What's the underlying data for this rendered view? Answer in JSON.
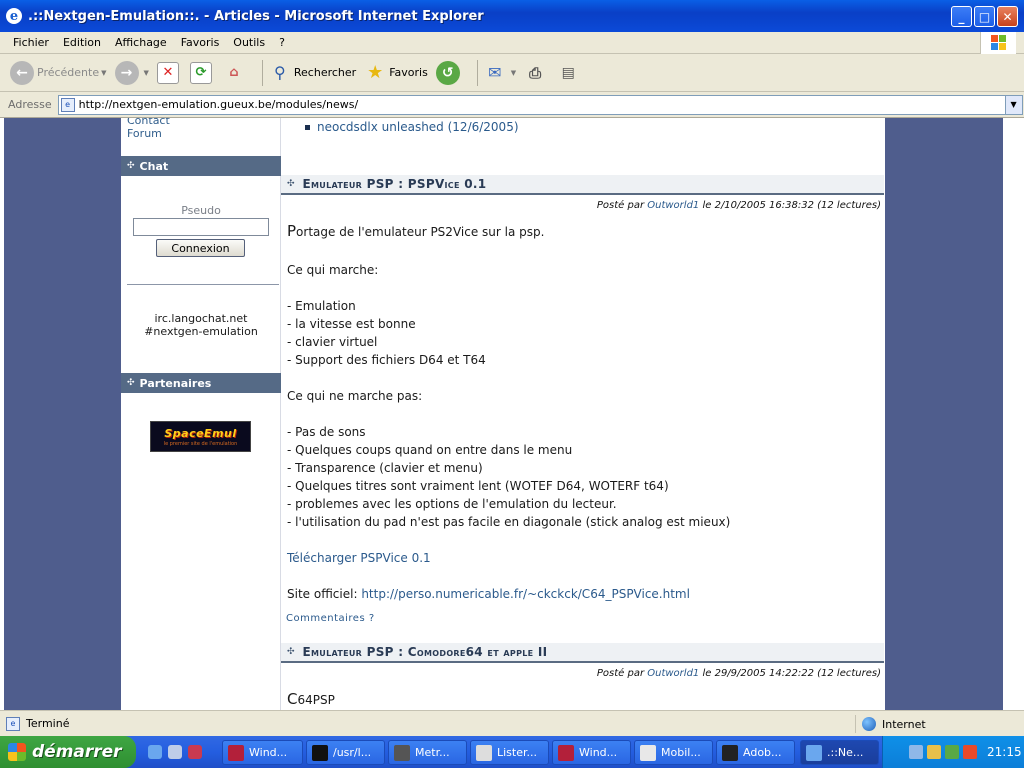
{
  "window": {
    "title": ".::Nextgen-Emulation::. - Articles - Microsoft Internet Explorer",
    "controls": {
      "minimize": "_",
      "maximize": "□",
      "close": "✕"
    }
  },
  "menu": [
    "Fichier",
    "Edition",
    "Affichage",
    "Favoris",
    "Outils",
    "?"
  ],
  "toolbar": {
    "back": "Précédente",
    "search": "Rechercher",
    "favorites": "Favoris"
  },
  "address": {
    "label": "Adresse",
    "url": "http://nextgen-emulation.gueux.be/modules/news/"
  },
  "sidebar": {
    "links": [
      "Contact",
      "Forum"
    ],
    "chat": {
      "title": "Chat",
      "pseudo_label": "Pseudo",
      "button": "Connexion",
      "server": "irc.langochat.net",
      "channel": "#nextgen-emulation"
    },
    "partners": {
      "title": "Partenaires",
      "logo_text": "SpaceEmul",
      "logo_sub": "le premier site de l'emulation"
    }
  },
  "content": {
    "top_bullet": "neocdsdlx unleashed (12/6/2005)",
    "article1": {
      "title": "Emulateur PSP : PSPVice 0.1",
      "posted_prefix": "Posté par",
      "author": "Outworld1",
      "posted_suffix": "le 2/10/2005 16:38:32 (12 lectures)",
      "intro_first": "P",
      "intro_rest": "ortage de l'emulateur PS2Vice sur la psp.",
      "works_title": "Ce qui marche:",
      "works": [
        "- Emulation",
        "- la vitesse est bonne",
        "- clavier virtuel",
        "- Support des fichiers D64 et T64"
      ],
      "notworks_title": "Ce qui ne marche pas:",
      "notworks": [
        "- Pas de sons",
        "- Quelques coups quand on entre dans le menu",
        "- Transparence (clavier et menu)",
        "- Quelques titres sont vraiment lent (WOTEF D64, WOTERF t64)",
        "- problemes avec les options de l'emulation du lecteur.",
        "- l'utilisation du pad n'est pas facile en diagonale (stick analog est mieux)"
      ],
      "download": "Télécharger PSPVice 0.1",
      "site_label": "Site officiel:",
      "site_url": "http://perso.numericable.fr/~ckckck/C64_PSPVice.html",
      "comments": "Commentaires ?"
    },
    "article2": {
      "title": "Emulateur PSP : Comodore64 et apple II",
      "posted_prefix": "Posté par",
      "author": "Outworld1",
      "posted_suffix": "le 29/9/2005 14:22:22 (12 lectures)",
      "intro_first": "C",
      "intro_rest": "64PSP"
    }
  },
  "status": {
    "text": "Terminé",
    "zone": "Internet"
  },
  "taskbar": {
    "start": "démarrer",
    "tasks": [
      "Wind...",
      "/usr/l...",
      "Metr...",
      "Lister...",
      "Wind...",
      "Mobil...",
      "Adob...",
      ".::Ne..."
    ],
    "clock": "21:15"
  },
  "colors": {
    "title_blue": "#0a3fc6",
    "page_bg": "#4f5d8d",
    "block_header": "#556a86",
    "link": "#2b5a8c"
  }
}
